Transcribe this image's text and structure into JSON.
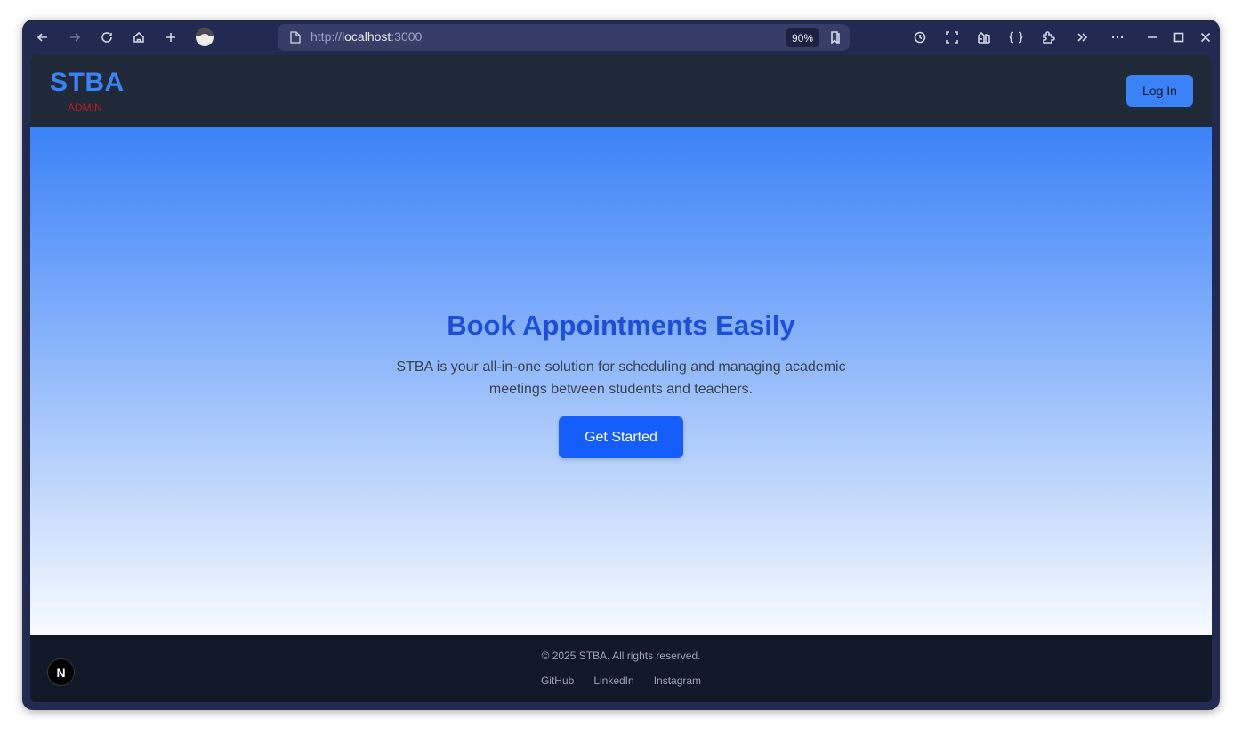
{
  "browser": {
    "url_scheme": "http://",
    "url_host": "localhost",
    "url_port": ":3000",
    "zoom": "90%",
    "icons": [
      "back-icon",
      "forward-icon",
      "reload-icon",
      "home-icon",
      "new-tab-icon",
      "profile-avatar",
      "page-icon",
      "bookmark-icon",
      "history-icon",
      "screenshot-icon",
      "library-icon",
      "devtools-icon",
      "extensions-icon",
      "overflow-chevrons-icon",
      "menu-icon",
      "minimize-icon",
      "maximize-icon",
      "close-icon"
    ]
  },
  "header": {
    "logo": "STBA",
    "logo_sub": "ADMIN",
    "login_label": "Log In"
  },
  "hero": {
    "title": "Book Appointments Easily",
    "text": "STBA is your all-in-one solution for scheduling and managing academic meetings between students and teachers.",
    "cta_label": "Get Started"
  },
  "footer": {
    "copyright": "© 2025 STBA. All rights reserved.",
    "links": [
      "GitHub",
      "LinkedIn",
      "Instagram"
    ]
  },
  "dev_badge": "N",
  "colors": {
    "accent": "#3b82f6",
    "cta": "#155dfc",
    "title": "#1d4ed8",
    "admin_red": "#c01a1a",
    "header_bg": "#1f2937",
    "footer_bg": "#111827"
  }
}
